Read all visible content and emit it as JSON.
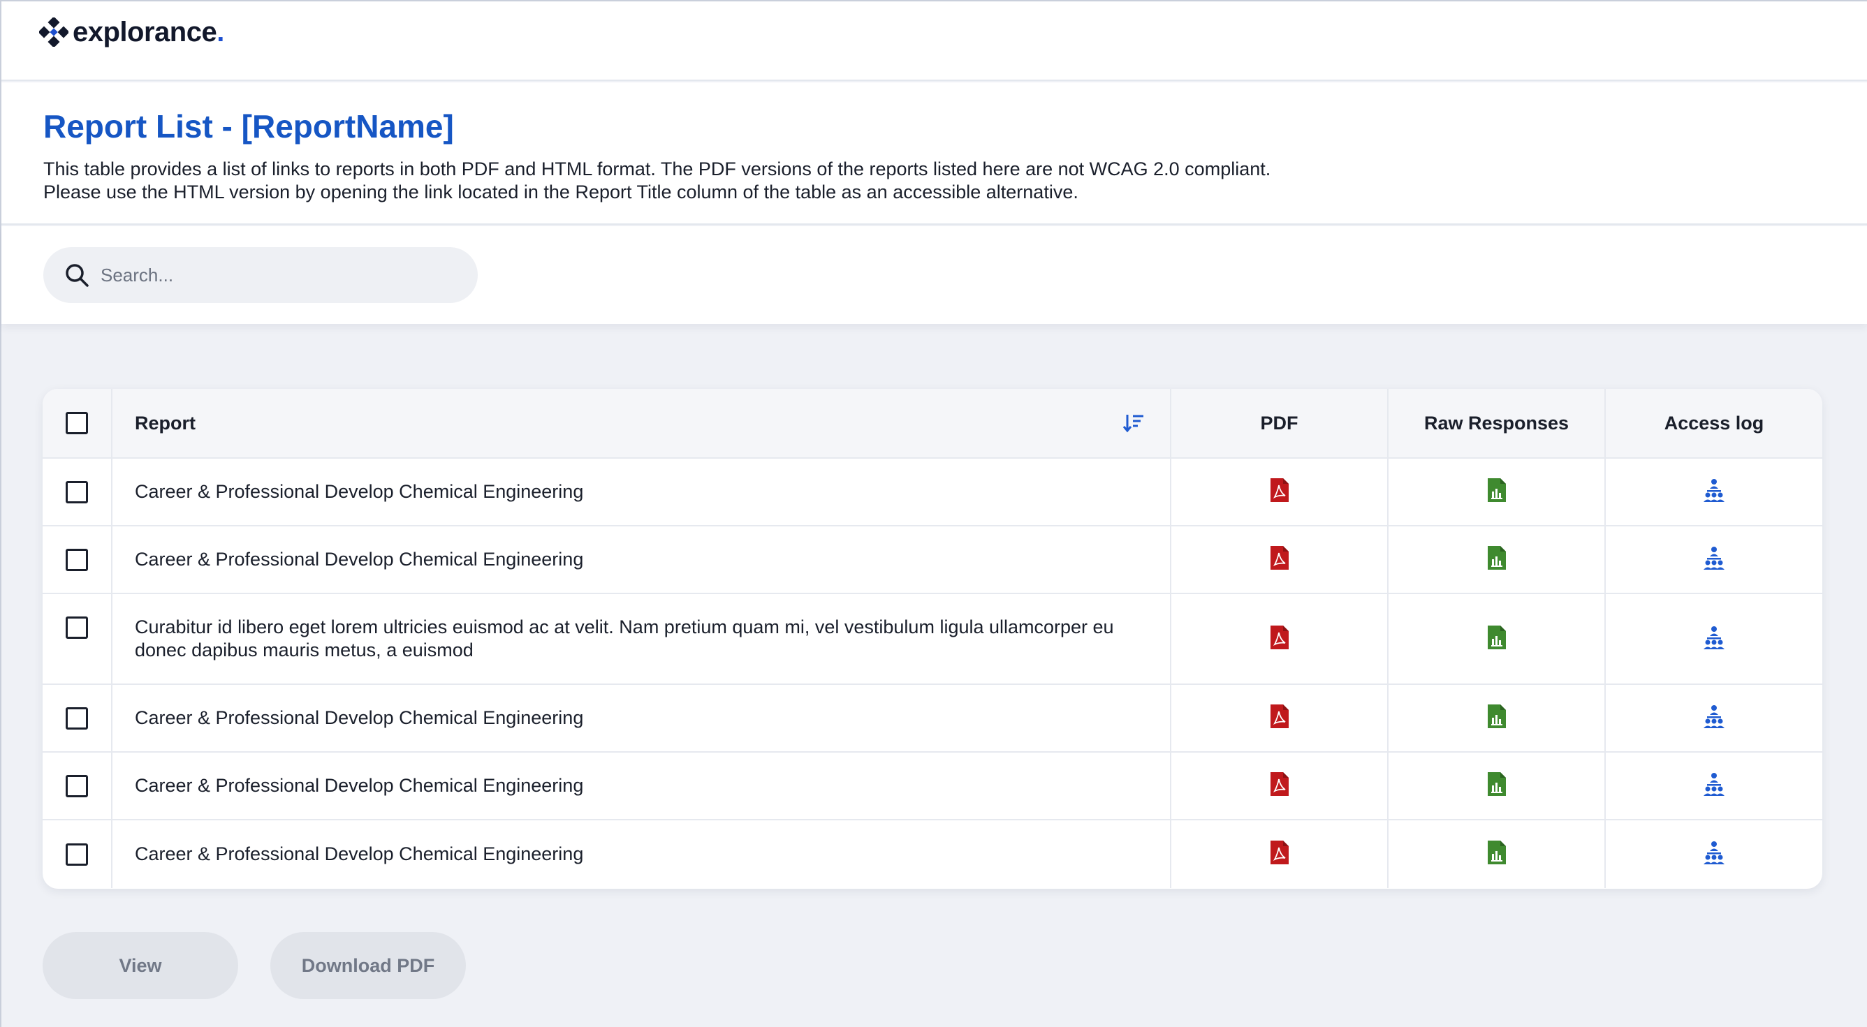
{
  "brand": {
    "name": "explorance",
    "suffix": "."
  },
  "header": {
    "title": "Report List - [ReportName]",
    "description_line1": "This table provides a list of links to reports in both PDF and HTML format. The PDF versions of the reports listed here are not WCAG 2.0 compliant.",
    "description_line2": "Please use the HTML version by opening the link located in the Report Title column of the table as an accessible alternative."
  },
  "search": {
    "placeholder": "Search...",
    "value": "",
    "icon": "search-icon"
  },
  "table": {
    "columns": {
      "report": "Report",
      "pdf": "PDF",
      "raw": "Raw Responses",
      "log": "Access log"
    },
    "rows": [
      {
        "report": "Career & Professional Develop Chemical Engineering",
        "checked": false
      },
      {
        "report": "Career & Professional Develop Chemical Engineering",
        "checked": false
      },
      {
        "report": "Curabitur id libero eget lorem ultricies euismod ac at velit. Nam pretium quam mi, vel vestibulum ligula ullamcorper eu donec dapibus mauris metus, a euismod",
        "checked": false
      },
      {
        "report": "Career & Professional Develop Chemical Engineering",
        "checked": false
      },
      {
        "report": "Career & Professional Develop Chemical Engineering",
        "checked": false
      },
      {
        "report": "Career & Professional Develop Chemical Engineering",
        "checked": false
      }
    ],
    "icons": {
      "pdf": "pdf-file-icon",
      "raw": "spreadsheet-chart-icon",
      "log": "people-hierarchy-icon",
      "sort": "sort-descending-icon"
    }
  },
  "actions": {
    "view_label": "View",
    "download_label": "Download PDF"
  },
  "colors": {
    "title": "#1656c4",
    "pdf_icon": "#c0191c",
    "raw_icon": "#3f8a2f",
    "log_icon": "#1f5bd1",
    "button_bg": "#e1e4ea",
    "button_text": "#717887"
  }
}
